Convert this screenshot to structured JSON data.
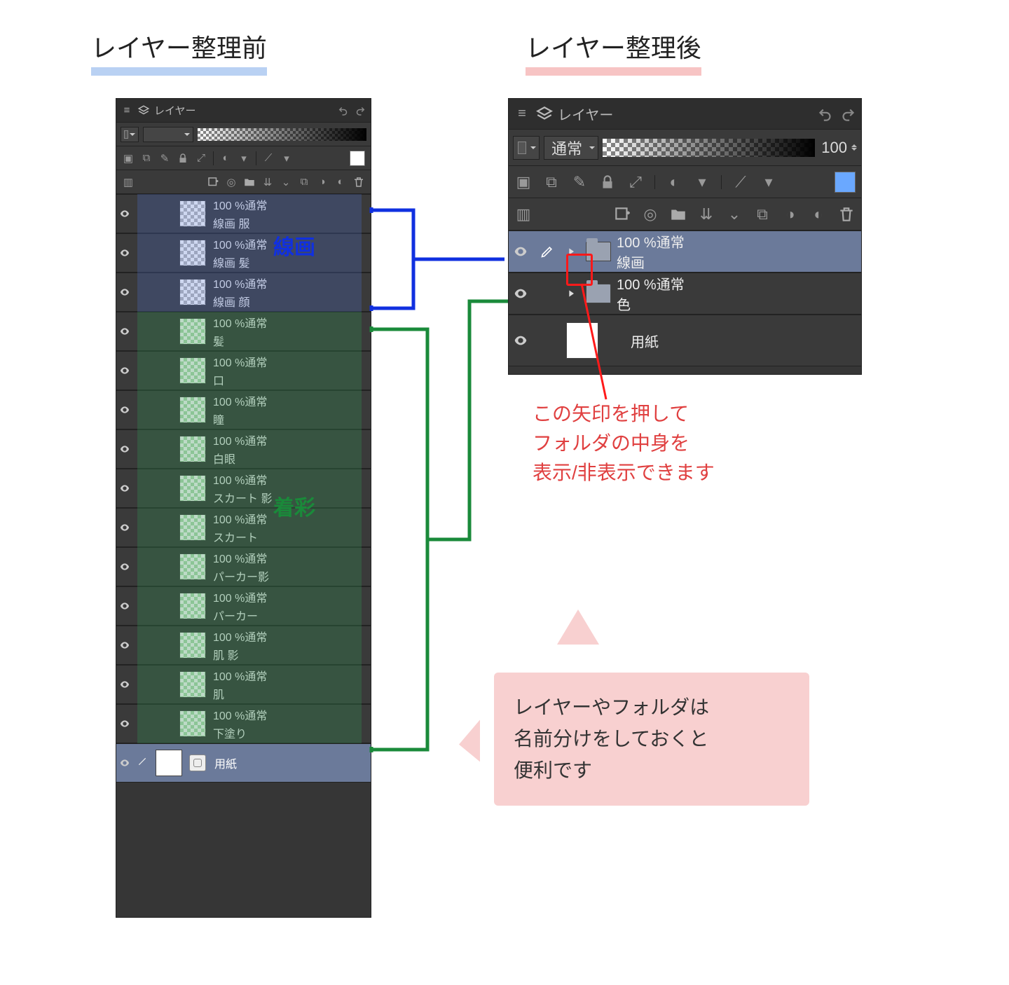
{
  "headings": {
    "before": "レイヤー整理前",
    "after": "レイヤー整理後"
  },
  "panel_generic": {
    "title": "レイヤー",
    "blend_normal": "通常",
    "opacity_100": "100",
    "info_100_normal": "100 %通常"
  },
  "before_panel": {
    "layers": [
      {
        "name": "線画 服",
        "info": "100 %通常",
        "group": "senga"
      },
      {
        "name": "線画 髪",
        "info": "100 %通常",
        "group": "senga"
      },
      {
        "name": "線画 顔",
        "info": "100 %通常",
        "group": "senga"
      },
      {
        "name": "髪",
        "info": "100 %通常",
        "group": "iro"
      },
      {
        "name": "口",
        "info": "100 %通常",
        "group": "iro"
      },
      {
        "name": "瞳",
        "info": "100 %通常",
        "group": "iro"
      },
      {
        "name": "白眼",
        "info": "100 %通常",
        "group": "iro"
      },
      {
        "name": "スカート 影",
        "info": "100 %通常",
        "group": "iro"
      },
      {
        "name": "スカート",
        "info": "100 %通常",
        "group": "iro"
      },
      {
        "name": "パーカー影",
        "info": "100 %通常",
        "group": "iro"
      },
      {
        "name": "パーカー",
        "info": "100 %通常",
        "group": "iro"
      },
      {
        "name": "肌 影",
        "info": "100 %通常",
        "group": "iro"
      },
      {
        "name": "肌",
        "info": "100 %通常",
        "group": "iro"
      },
      {
        "name": "下塗り",
        "info": "100 %通常",
        "group": "iro"
      }
    ],
    "paper": "用紙",
    "group_labels": {
      "senga": "線画",
      "chaku": "着彩"
    }
  },
  "after_panel": {
    "folders": [
      {
        "name": "線画",
        "info": "100 %通常",
        "selected": true
      },
      {
        "name": "色",
        "info": "100 %通常",
        "selected": false
      }
    ],
    "paper": "用紙"
  },
  "annotations": {
    "arrow_hint": "この矢印を押して\nフォルダの中身を\n表示/非表示できます",
    "callout": "レイヤーやフォルダは\n名前分けをしておくと\n便利です"
  },
  "colors": {
    "senga_line": "#1030e0",
    "iro_line": "#1a8a3a",
    "red": "#ff1a1a"
  }
}
